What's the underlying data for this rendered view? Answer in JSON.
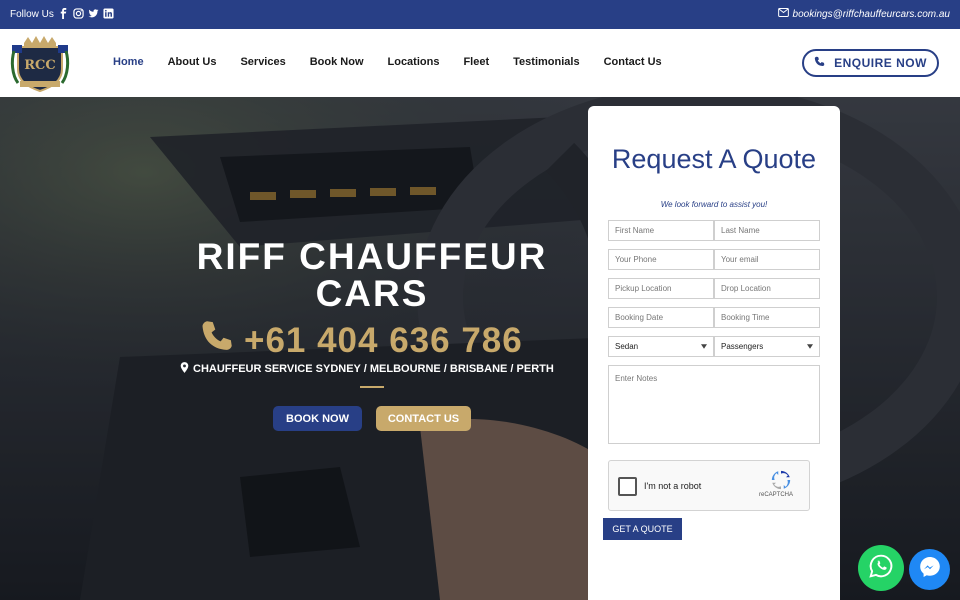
{
  "topbar": {
    "follow_label": "Follow Us",
    "social_icons": [
      "facebook-icon",
      "instagram-icon",
      "twitter-icon",
      "linkedin-icon"
    ],
    "email": "bookings@riffchauffeurcars.com.au"
  },
  "nav": {
    "items": [
      "Home",
      "About Us",
      "Services",
      "Book Now",
      "Locations",
      "Fleet",
      "Testimonials",
      "Contact Us"
    ],
    "active": "Home",
    "enquire_label": "ENQUIRE NOW"
  },
  "hero": {
    "title": "RIFF CHAUFFEUR CARS",
    "phone": "+61 404 636 786",
    "service_line": "CHAUFFEUR SERVICE SYDNEY / MELBOURNE / BRISBANE / PERTH",
    "book_label": "BOOK NOW",
    "contact_label": "CONTACT US"
  },
  "quote": {
    "title": "Request A Quote",
    "subtitle": "We look forward to assist you!",
    "placeholders": {
      "first_name": "First Name",
      "last_name": "Last Name",
      "phone": "Your Phone",
      "email": "Your email",
      "pickup": "Pickup Location",
      "drop": "Drop Location",
      "date": "Booking Date",
      "time": "Booking Time",
      "notes": "Enter Notes"
    },
    "vehicle_selected": "Sedan",
    "passengers_selected": "Passengers",
    "captcha_label": "I'm not a robot",
    "captcha_brand": "reCAPTCHA",
    "submit_label": "GET A QUOTE"
  },
  "colors": {
    "brand_blue": "#283f86",
    "gold": "#c8a96b",
    "whatsapp": "#25d366",
    "messenger": "#1f88f5"
  }
}
